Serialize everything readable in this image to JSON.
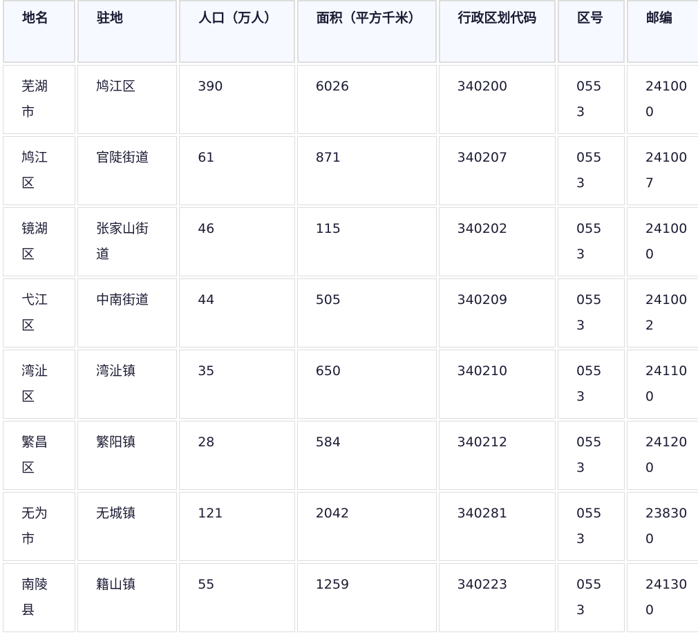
{
  "table": {
    "headers": [
      "地名",
      "驻地",
      "人口（万人）",
      "面积（平方千米）",
      "行政区划代码",
      "区号",
      "邮编"
    ],
    "rows": [
      [
        "芜湖市",
        "鸠江区",
        "390",
        "6026",
        "340200",
        "0553",
        "241000"
      ],
      [
        "鸠江区",
        "官陡街道",
        "61",
        "871",
        "340207",
        "0553",
        "241007"
      ],
      [
        "镜湖区",
        "张家山街道",
        "46",
        "115",
        "340202",
        "0553",
        "241000"
      ],
      [
        "弋江区",
        "中南街道",
        "44",
        "505",
        "340209",
        "0553",
        "241002"
      ],
      [
        "湾沚区",
        "湾沚镇",
        "35",
        "650",
        "340210",
        "0553",
        "241100"
      ],
      [
        "繁昌区",
        "繁阳镇",
        "28",
        "584",
        "340212",
        "0553",
        "241200"
      ],
      [
        "无为市",
        "无城镇",
        "121",
        "2042",
        "340281",
        "0553",
        "238300"
      ],
      [
        "南陵县",
        "籍山镇",
        "55",
        "1259",
        "340223",
        "0553",
        "241300"
      ]
    ]
  }
}
